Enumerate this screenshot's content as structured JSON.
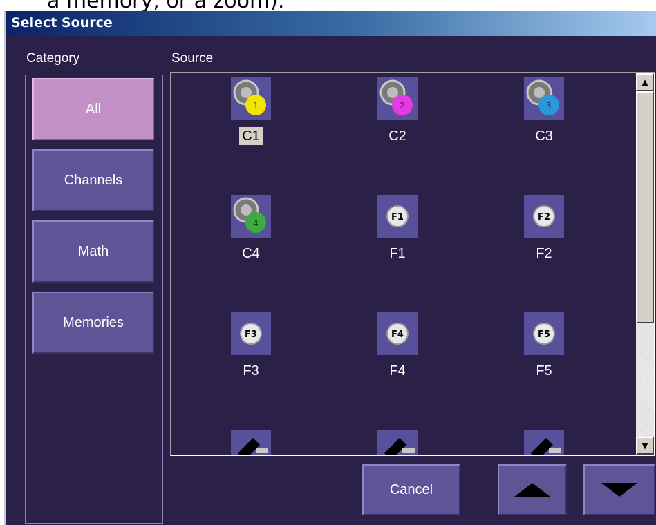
{
  "document_text": "a memory, or a zoom).",
  "window": {
    "title": "Select Source"
  },
  "category": {
    "header": "Category",
    "items": [
      {
        "label": "All",
        "active": true
      },
      {
        "label": "Channels",
        "active": false
      },
      {
        "label": "Math",
        "active": false
      },
      {
        "label": "Memories",
        "active": false
      }
    ]
  },
  "source": {
    "header": "Source",
    "items": [
      {
        "label": "C1",
        "icon": "channel-1-icon",
        "color": "#f2e600",
        "num": "1",
        "selected": true
      },
      {
        "label": "C2",
        "icon": "channel-2-icon",
        "color": "#e43be4",
        "num": "2",
        "selected": false
      },
      {
        "label": "C3",
        "icon": "channel-3-icon",
        "color": "#2a98d8",
        "num": "3",
        "selected": false
      },
      {
        "label": "C4",
        "icon": "channel-4-icon",
        "color": "#3cad3c",
        "num": "4",
        "selected": false
      },
      {
        "label": "F1",
        "icon": "function-1-icon",
        "badge": "F1",
        "selected": false
      },
      {
        "label": "F2",
        "icon": "function-2-icon",
        "badge": "F2",
        "selected": false
      },
      {
        "label": "F3",
        "icon": "function-3-icon",
        "badge": "F3",
        "selected": false
      },
      {
        "label": "F4",
        "icon": "function-4-icon",
        "badge": "F4",
        "selected": false
      },
      {
        "label": "F5",
        "icon": "function-5-icon",
        "badge": "F5",
        "selected": false
      },
      {
        "label": "",
        "icon": "memory-1-icon",
        "selected": false
      },
      {
        "label": "",
        "icon": "memory-2-icon",
        "selected": false
      },
      {
        "label": "",
        "icon": "memory-3-icon",
        "selected": false
      }
    ]
  },
  "buttons": {
    "cancel": "Cancel",
    "page_up_icon": "up-arrow-icon",
    "page_down_icon": "down-arrow-icon"
  },
  "scrollbar": {
    "up": "▲",
    "down": "▼"
  }
}
